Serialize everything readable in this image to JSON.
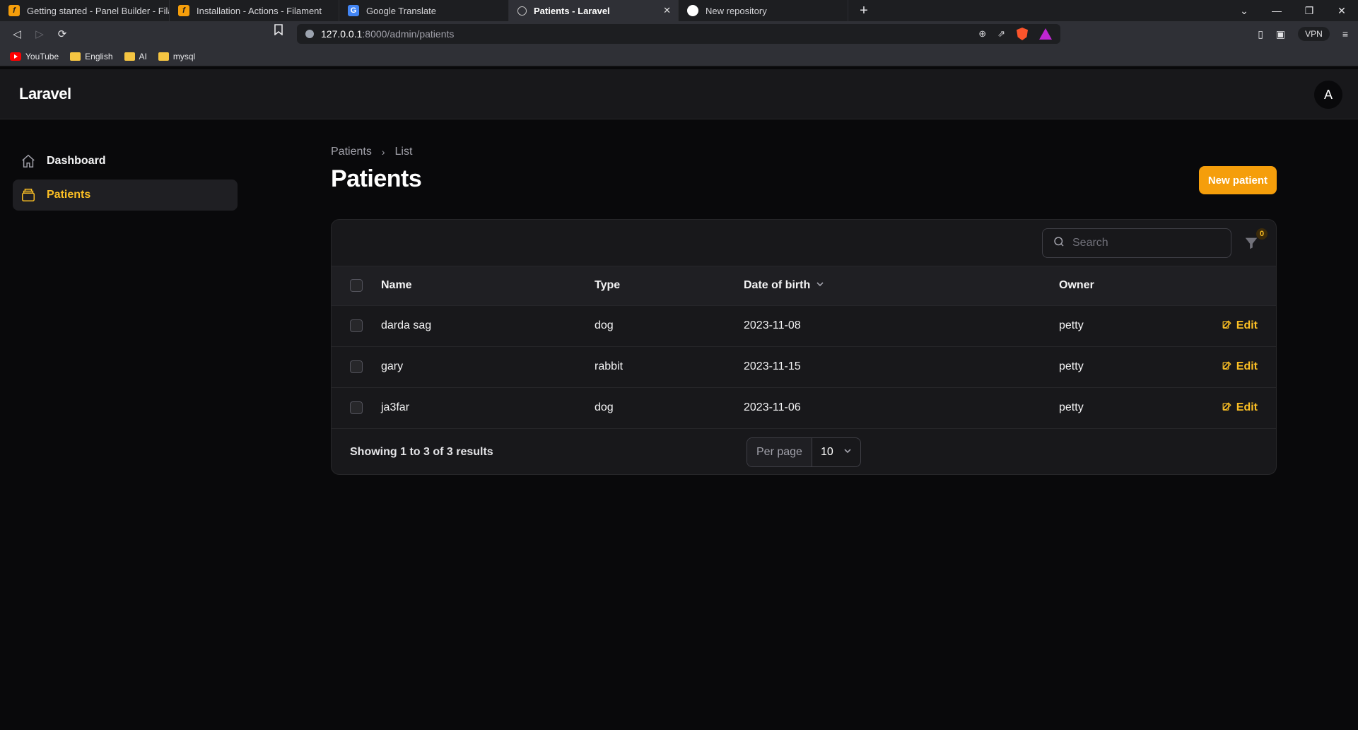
{
  "browser": {
    "tabs": [
      {
        "title": "Getting started - Panel Builder - Filam",
        "icon": "filament-icon"
      },
      {
        "title": "Installation - Actions - Filament",
        "icon": "filament-icon"
      },
      {
        "title": "Google Translate",
        "icon": "google-translate-icon"
      },
      {
        "title": "Patients - Laravel",
        "icon": "globe-icon",
        "active": true
      },
      {
        "title": "New repository",
        "icon": "github-icon"
      }
    ],
    "url_host": "127.0.0.1",
    "url_path": ":8000/admin/patients",
    "vpn_label": "VPN",
    "bookmarks": [
      {
        "label": "YouTube",
        "icon": "youtube-icon"
      },
      {
        "label": "English",
        "icon": "folder-icon"
      },
      {
        "label": "AI",
        "icon": "folder-icon"
      },
      {
        "label": "mysql",
        "icon": "folder-icon"
      }
    ]
  },
  "app": {
    "brand": "Laravel",
    "avatar_initial": "A",
    "accent_color": "#f59e0b"
  },
  "sidebar": {
    "items": [
      {
        "label": "Dashboard",
        "icon": "home-icon"
      },
      {
        "label": "Patients",
        "icon": "archive-box-icon",
        "active": true
      }
    ]
  },
  "page": {
    "breadcrumb": [
      "Patients",
      "List"
    ],
    "title": "Patients",
    "new_button": "New patient"
  },
  "table": {
    "search_placeholder": "Search",
    "filter_count": "0",
    "columns": [
      "Name",
      "Type",
      "Date of birth",
      "Owner"
    ],
    "rows": [
      {
        "name": "darda sag",
        "type": "dog",
        "dob": "2023-11-08",
        "owner": "petty",
        "action": "Edit"
      },
      {
        "name": "gary",
        "type": "rabbit",
        "dob": "2023-11-15",
        "owner": "petty",
        "action": "Edit"
      },
      {
        "name": "ja3far",
        "type": "dog",
        "dob": "2023-11-06",
        "owner": "petty",
        "action": "Edit"
      }
    ],
    "results_text": "Showing 1 to 3 of 3 results",
    "per_page_label": "Per page",
    "per_page_value": "10"
  }
}
